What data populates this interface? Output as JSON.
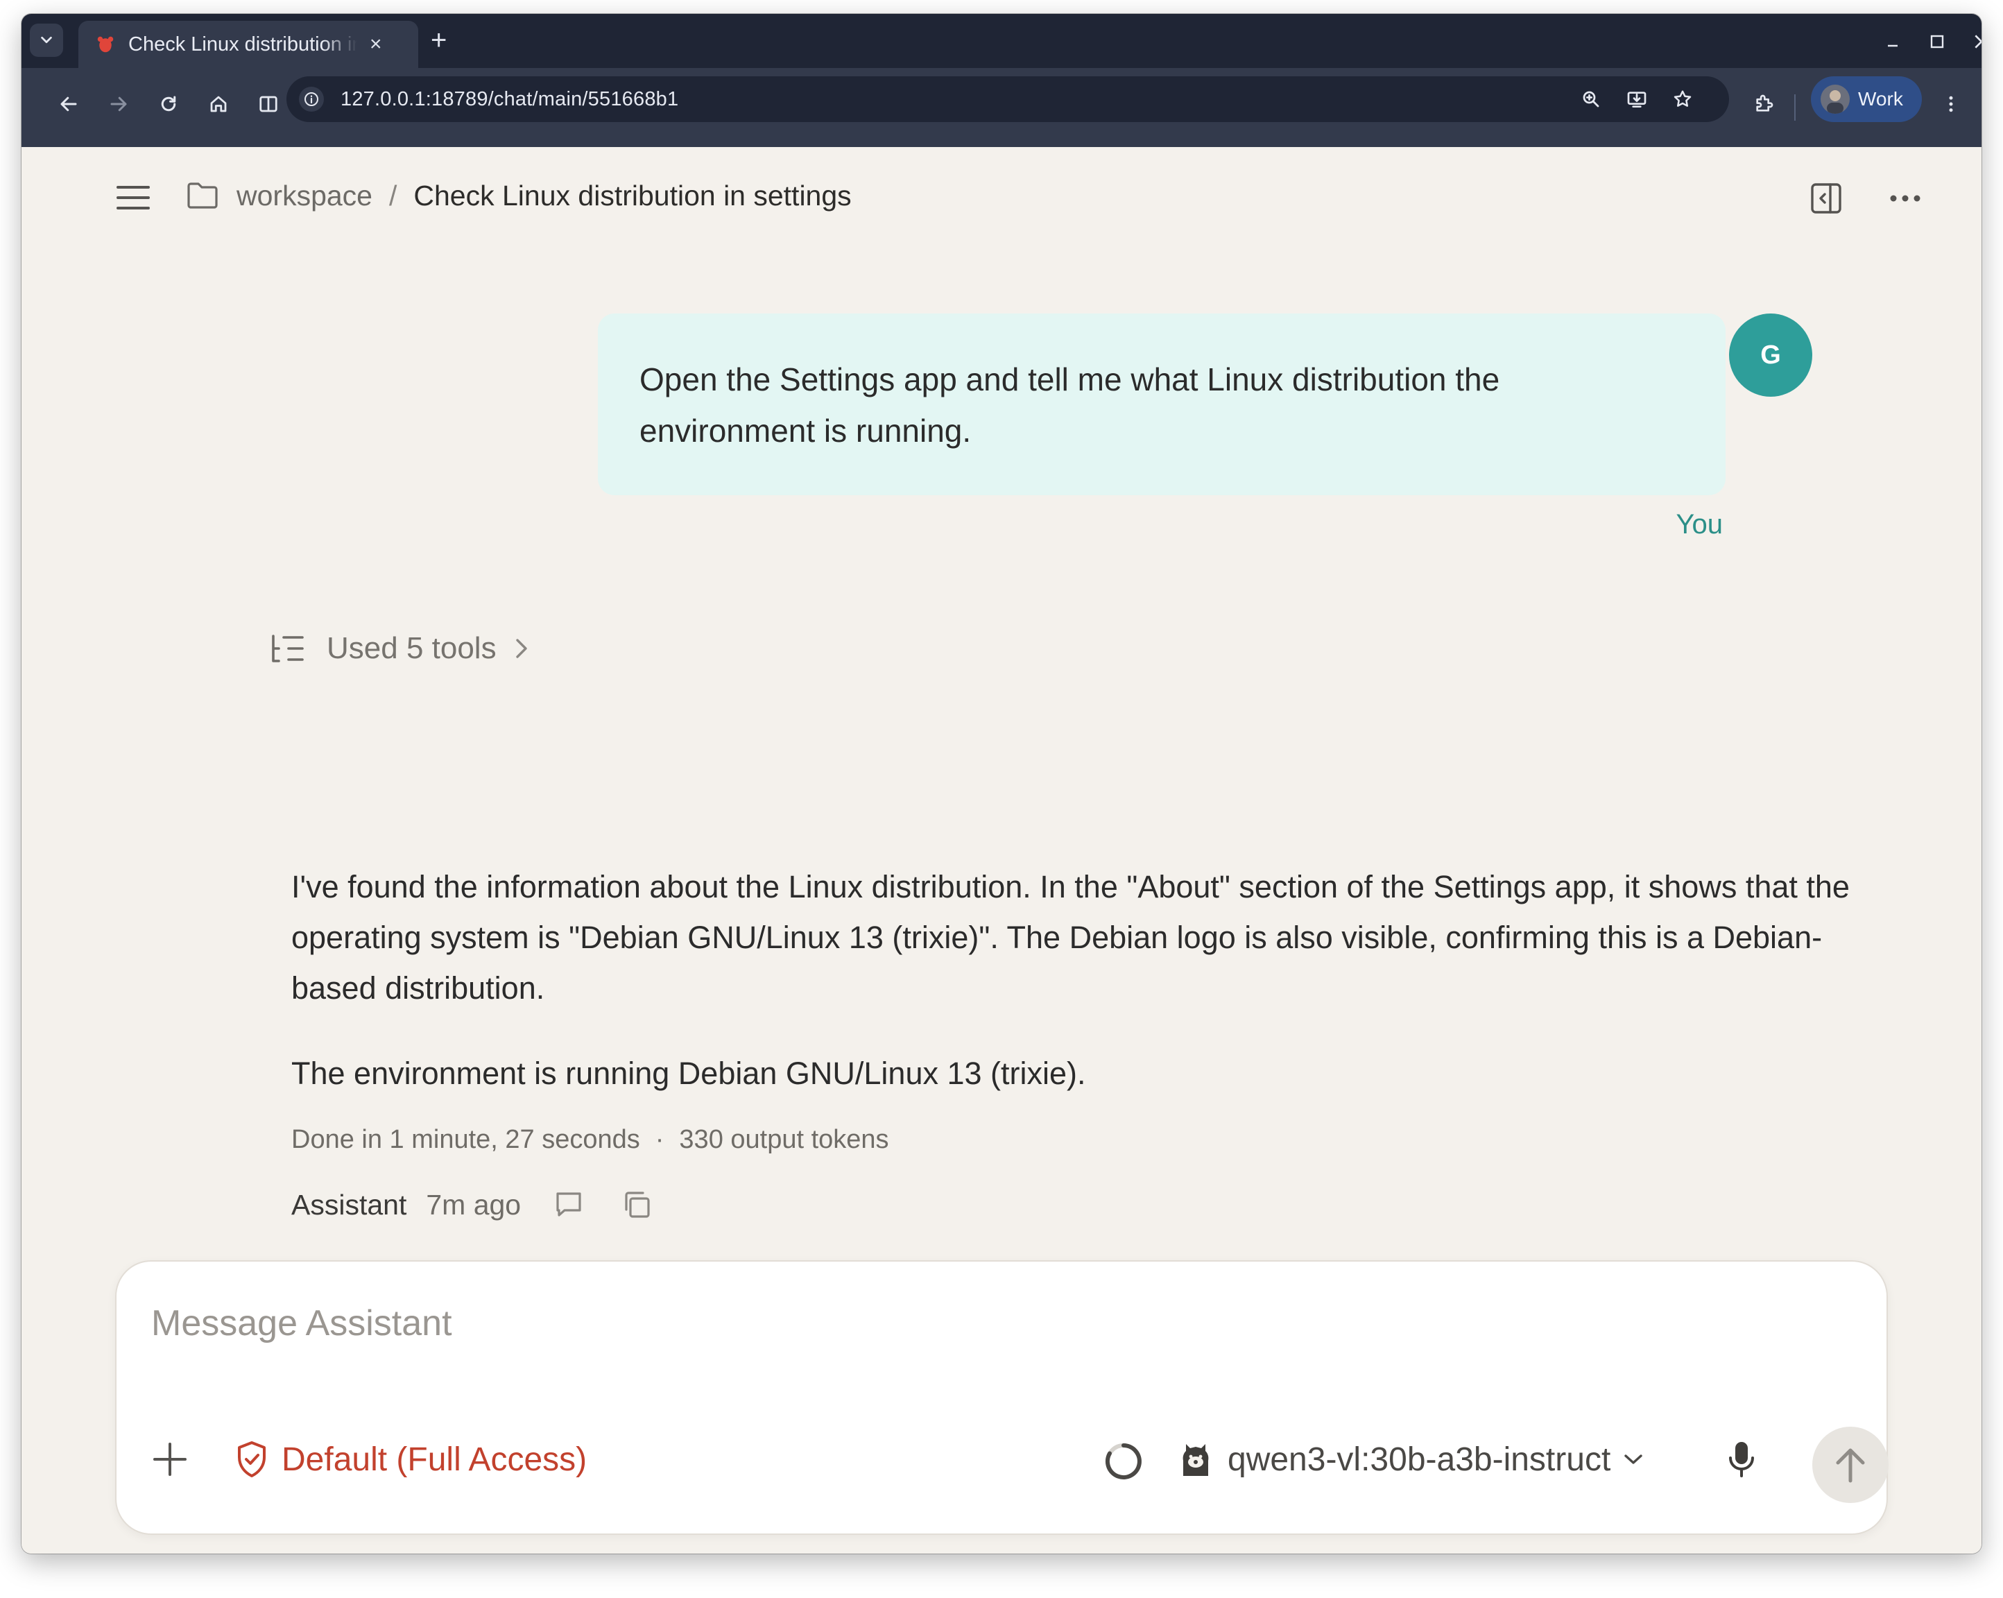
{
  "browser": {
    "tab_title": "Check Linux distribution in settings",
    "tab_close": "×",
    "new_tab": "+",
    "url": "127.0.0.1:18789/chat/main/551668b1",
    "profile_label": "Work"
  },
  "header": {
    "breadcrumb_workspace": "workspace",
    "breadcrumb_separator": "/",
    "breadcrumb_title": "Check Linux distribution in settings"
  },
  "user_message": {
    "avatar_initial": "G",
    "text": "Open the Settings app and tell me what Linux distribution the environment is running.",
    "author": "You"
  },
  "assistant_message": {
    "tools_summary": "Used 5 tools",
    "paragraphs": [
      "I've found the information about the Linux distribution. In the \"About\" section of the Settings app, it shows that the operating system is \"Debian GNU/Linux 13 (trixie)\". The Debian logo is also visible, confirming this is a Debian-based distribution.",
      "The environment is running Debian GNU/Linux 13 (trixie)."
    ],
    "duration": "Done in 1 minute, 27 seconds",
    "meta_separator": "·",
    "tokens": "330 output tokens",
    "author": "Assistant",
    "time": "7m ago"
  },
  "composer": {
    "placeholder": "Message Assistant",
    "access_mode": "Default (Full Access)",
    "model": "qwen3-vl:30b-a3b-instruct"
  },
  "colors": {
    "accent_teal": "#2e9e9a",
    "access_red": "#c2412d",
    "user_bubble": "#e3f6f3",
    "app_background": "#f4f1ec"
  },
  "icons": {
    "tab_search": "chevron-down-icon",
    "favicon": "lobster-icon",
    "access": "shield-check-icon",
    "model": "llama-icon"
  }
}
